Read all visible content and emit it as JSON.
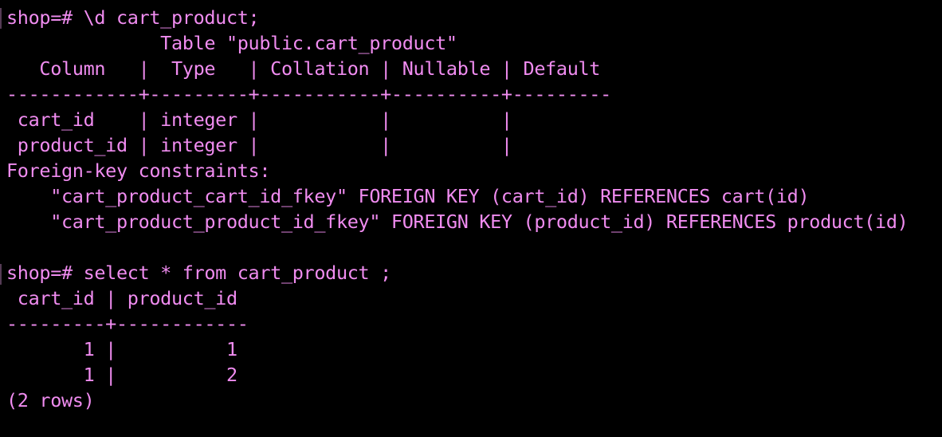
{
  "terminal": {
    "fg_color": "#f08cf0",
    "bg_color": "#000000",
    "lines": [
      "shop=# \\d cart_product;",
      "              Table \"public.cart_product\"",
      "   Column   |  Type   | Collation | Nullable | Default",
      "------------+---------+-----------+----------+---------",
      " cart_id    | integer |           |          |",
      " product_id | integer |           |          |",
      "Foreign-key constraints:",
      "    \"cart_product_cart_id_fkey\" FOREIGN KEY (cart_id) REFERENCES cart(id)",
      "    \"cart_product_product_id_fkey\" FOREIGN KEY (product_id) REFERENCES product(id)",
      "",
      "shop=# select * from cart_product ;",
      " cart_id | product_id",
      "---------+------------",
      "       1 |          1",
      "       1 |          2",
      "(2 rows)"
    ]
  }
}
